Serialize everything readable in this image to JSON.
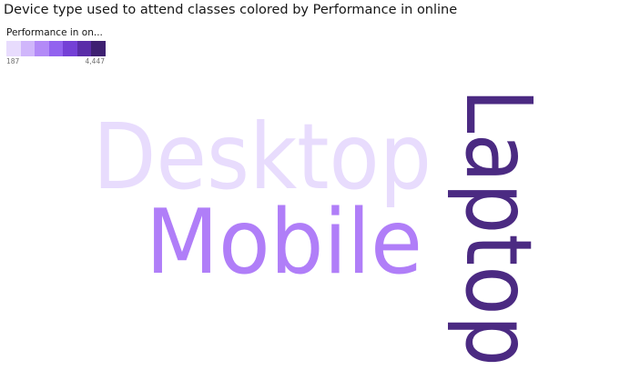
{
  "title": "Device type used to attend classes colored by Performance in online",
  "legend": {
    "title": "Performance in on...",
    "min_label": "187",
    "max_label": "4,447",
    "swatches": [
      "#e8dcfd",
      "#d0b6fb",
      "#b38af7",
      "#9262ef",
      "#7440d6",
      "#5a2da8",
      "#3e2071"
    ]
  },
  "chart_data": {
    "type": "word_cloud",
    "title": "Device type used to attend classes colored by Performance in online",
    "color_field": "Performance in on...",
    "color_range": [
      187,
      4447
    ],
    "words": [
      {
        "text": "Desktop",
        "color": "#e8dcfd",
        "orientation": "horizontal"
      },
      {
        "text": "Mobile",
        "color": "#b07ef8",
        "orientation": "horizontal"
      },
      {
        "text": "Laptop",
        "color": "#4b2a82",
        "orientation": "vertical"
      }
    ]
  }
}
